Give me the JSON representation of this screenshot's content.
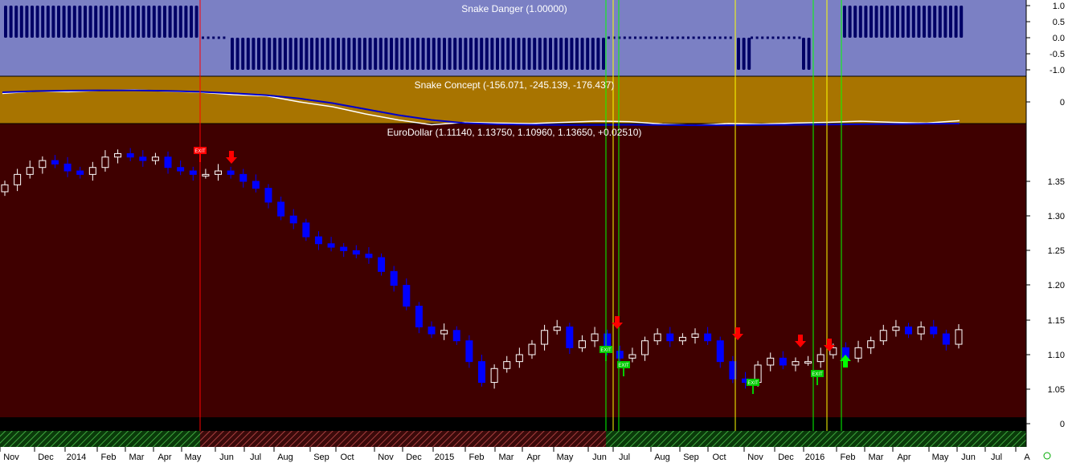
{
  "colors": {
    "danger_bg": "#7b80c4",
    "concept_bg": "#a87400",
    "main_bg": "#3f0000",
    "axis_bg": "#ffffff",
    "bull_candle": "#ffffff",
    "bear_candle": "#0000ff",
    "concept_line_fast": "#ffffff",
    "concept_line_slow": "#0000cc",
    "signal_red": "#ff0000",
    "signal_green": "#00ff00",
    "signal_yellow": "#ffff00",
    "exit_label_bg": "#00cc00"
  },
  "chart_data": [
    {
      "type": "bar",
      "title": "Snake Danger (1.00000)",
      "ylim": [
        -1.0,
        1.0
      ],
      "yticks": [
        "1.0",
        "0.5",
        "0.0",
        "-0.5",
        "-1.0"
      ],
      "segments": [
        {
          "from": "Nov 2013",
          "to": "May 2014",
          "value": 1.0
        },
        {
          "from": "May 2014",
          "to": "Jun 2014",
          "value": 0.0
        },
        {
          "from": "Jun 2014",
          "to": "Jun 2015",
          "value": -1.0
        },
        {
          "from": "Jun 2015",
          "to": "Oct 2015",
          "value": 0.0
        },
        {
          "from": "Oct 2015",
          "to": "Nov 2015",
          "value": -1.0
        },
        {
          "from": "Nov 2015",
          "to": "Dec 2015",
          "value": 0.0
        },
        {
          "from": "Dec 2015",
          "to": "Jan 2016",
          "value": -1.0
        },
        {
          "from": "Feb 2016",
          "to": "May 2016",
          "value": 1.0
        }
      ]
    },
    {
      "type": "line",
      "title": "Snake Concept (-156.071, -245.139, -176.437)",
      "yticks": [
        "0"
      ],
      "series": [
        {
          "values": [
            0.35,
            0.45,
            0.42,
            0.48,
            0.5,
            0.44,
            0.4,
            0.3,
            0.25,
            0.0,
            -0.2,
            -0.5,
            -0.75,
            -0.95,
            -0.85,
            -0.88,
            -0.9,
            -0.85,
            -0.8,
            -0.82,
            -0.92,
            -0.97,
            -0.9,
            -0.92,
            -0.88,
            -0.85,
            -0.8,
            -0.85,
            -0.88,
            -0.78
          ]
        },
        {
          "values": [
            0.4,
            0.45,
            0.47,
            0.48,
            0.48,
            0.46,
            0.42,
            0.36,
            0.28,
            0.14,
            -0.05,
            -0.3,
            -0.55,
            -0.75,
            -0.88,
            -0.93,
            -0.95,
            -0.96,
            -0.96,
            -0.95,
            -0.96,
            -0.97,
            -0.97,
            -0.96,
            -0.95,
            -0.94,
            -0.93,
            -0.92,
            -0.91,
            -0.9
          ]
        }
      ]
    },
    {
      "type": "candlestick",
      "title": "EuroDollar (1.11140, 1.13750, 1.10960, 1.13650, +0.02510)",
      "ylim": [
        1.0,
        1.42
      ],
      "yticks": [
        "1.35",
        "1.30",
        "1.25",
        "1.20",
        "1.15",
        "1.10",
        "1.05",
        "0"
      ],
      "x_labels": [
        "Nov",
        "Dec",
        "2014",
        "Feb",
        "Mar",
        "Apr",
        "May",
        "Jun",
        "Jul",
        "Aug",
        "Sep",
        "Oct",
        "Nov",
        "Dec",
        "2015",
        "Feb",
        "Mar",
        "Apr",
        "May",
        "Jun",
        "Jul",
        "Aug",
        "Sep",
        "Oct",
        "Nov",
        "Dec",
        "2016",
        "Feb",
        "Mar",
        "Apr",
        "May",
        "Jun",
        "Jul",
        "A"
      ],
      "close_path": [
        1.345,
        1.36,
        1.37,
        1.38,
        1.375,
        1.365,
        1.36,
        1.37,
        1.385,
        1.39,
        1.385,
        1.38,
        1.385,
        1.37,
        1.365,
        1.36,
        1.36,
        1.365,
        1.36,
        1.35,
        1.34,
        1.32,
        1.3,
        1.29,
        1.27,
        1.26,
        1.255,
        1.25,
        1.245,
        1.24,
        1.22,
        1.2,
        1.17,
        1.14,
        1.13,
        1.135,
        1.12,
        1.09,
        1.06,
        1.08,
        1.09,
        1.1,
        1.115,
        1.135,
        1.14,
        1.11,
        1.12,
        1.13,
        1.105,
        1.095,
        1.1,
        1.12,
        1.13,
        1.12,
        1.125,
        1.13,
        1.12,
        1.09,
        1.065,
        1.06,
        1.085,
        1.095,
        1.085,
        1.09,
        1.09,
        1.1,
        1.11,
        1.095,
        1.11,
        1.12,
        1.135,
        1.14,
        1.13,
        1.14,
        1.13,
        1.115,
        1.136
      ],
      "annotations": [
        {
          "type": "exit",
          "label": "EXIT",
          "date": "May 2014",
          "color": "red"
        },
        {
          "type": "sell-arrow",
          "date": "Jun 2014"
        },
        {
          "type": "exit",
          "label": "EXIT",
          "date": "Jun 2015",
          "color": "green"
        },
        {
          "type": "sell-arrow",
          "date": "Jun 2015"
        },
        {
          "type": "exit",
          "label": "EXIT",
          "date": "Jul 2015",
          "color": "green"
        },
        {
          "type": "sell-arrow",
          "date": "Oct 2015"
        },
        {
          "type": "exit",
          "label": "EXIT",
          "date": "Nov 2015",
          "color": "green"
        },
        {
          "type": "sell-arrow",
          "date": "Dec 2015"
        },
        {
          "type": "exit",
          "label": "EXIT",
          "date": "Jan 2016",
          "color": "green"
        },
        {
          "type": "sell-arrow",
          "date": "Jan 2016"
        },
        {
          "type": "buy-arrow",
          "date": "Feb 2016"
        }
      ]
    }
  ]
}
